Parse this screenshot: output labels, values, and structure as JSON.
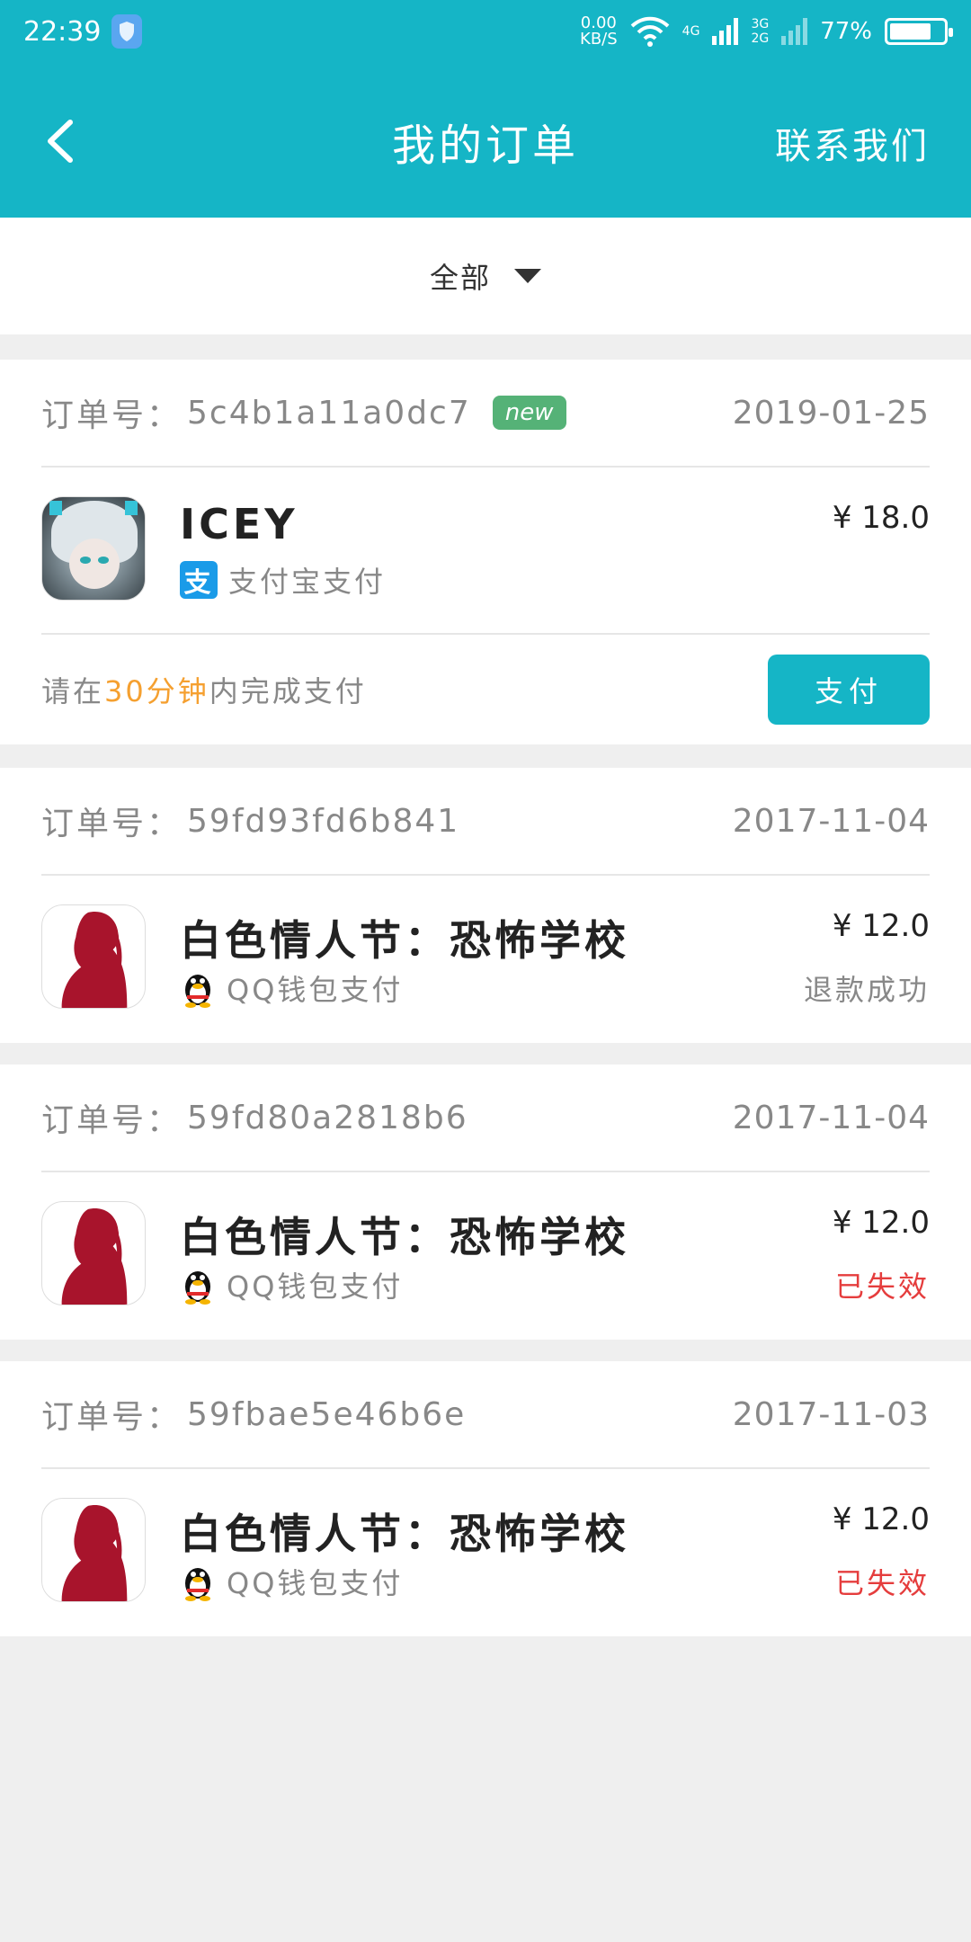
{
  "status_bar": {
    "time": "22:39",
    "net_speed": "0.00",
    "net_unit": "KB/S",
    "net1": "4G",
    "net2a": "3G",
    "net2b": "2G",
    "battery": "77%"
  },
  "header": {
    "title": "我的订单",
    "contact_label": "联系我们"
  },
  "filter": {
    "selected": "全部"
  },
  "orders": [
    {
      "order_no_label": "订单号：",
      "order_no": "5c4b1a11a0dc7",
      "badge": "new",
      "date": "2019-01-25",
      "product": "ICEY",
      "pay_method": "支付宝支付",
      "price": "¥ 18.0",
      "hint_prefix": "请在",
      "hint_highlight": "30分钟",
      "hint_suffix": "内完成支付",
      "pay_button": "支付"
    },
    {
      "order_no_label": "订单号：",
      "order_no": "59fd93fd6b841",
      "date": "2017-11-04",
      "product": "白色情人节：恐怖学校",
      "pay_method": "QQ钱包支付",
      "price": "¥ 12.0",
      "status": "退款成功"
    },
    {
      "order_no_label": "订单号：",
      "order_no": "59fd80a2818b6",
      "date": "2017-11-04",
      "product": "白色情人节：恐怖学校",
      "pay_method": "QQ钱包支付",
      "price": "¥ 12.0",
      "status": "已失效"
    },
    {
      "order_no_label": "订单号：",
      "order_no": "59fbae5e46b6e",
      "date": "2017-11-03",
      "product": "白色情人节：恐怖学校",
      "pay_method": "QQ钱包支付",
      "price": "¥ 12.0",
      "status": "已失效"
    }
  ],
  "icons": {
    "alipay": "支"
  },
  "colors": {
    "primary": "#15b5c6",
    "badge": "#55b277",
    "highlight": "#f5a030",
    "invalid": "#e53d3d"
  }
}
